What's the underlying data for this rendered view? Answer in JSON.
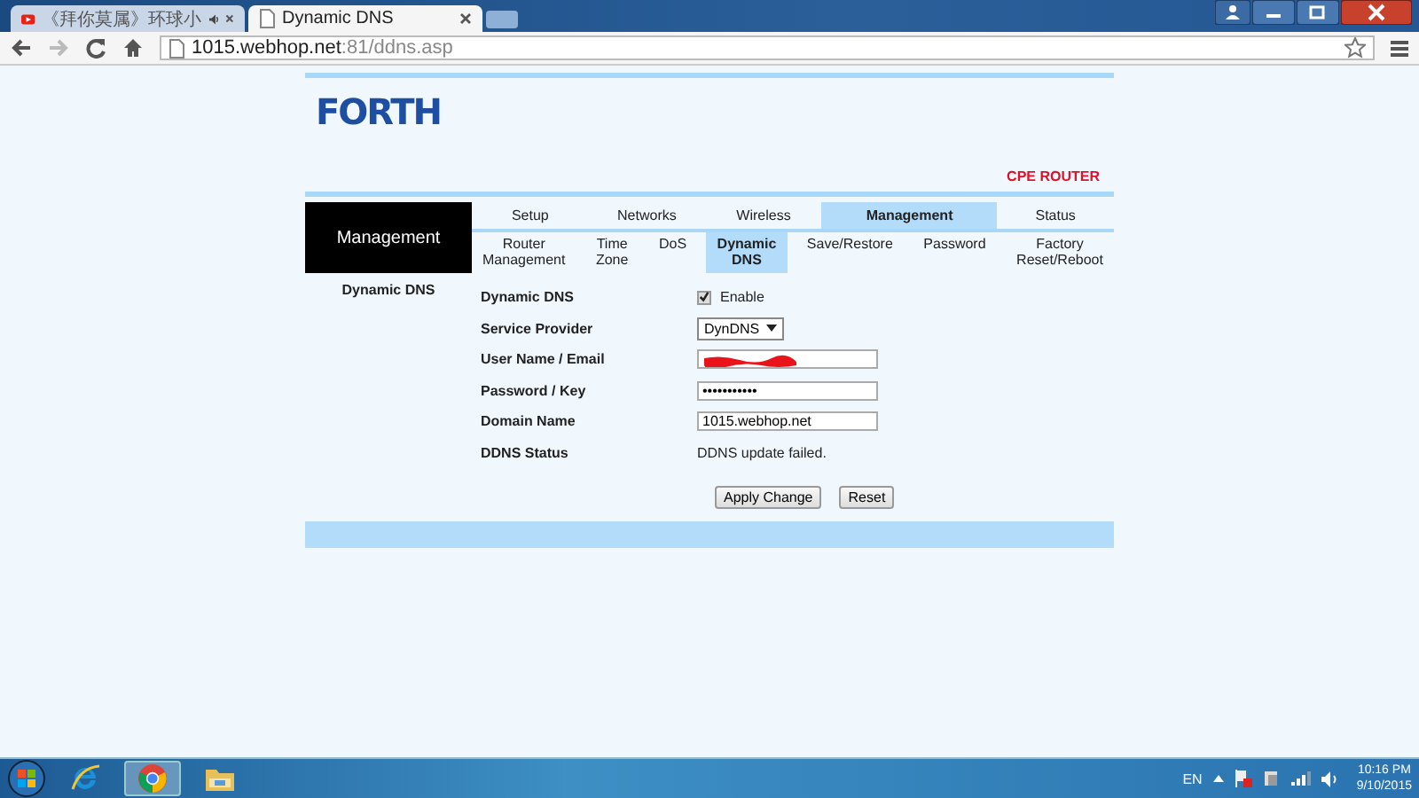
{
  "browser": {
    "tabs": [
      {
        "title": "《拜你莫属》环球小",
        "selected": false,
        "audio": true
      },
      {
        "title": "Dynamic DNS",
        "selected": true,
        "audio": false
      }
    ],
    "address": {
      "host": "1015.webhop.net",
      "rest": ":81/ddns.asp"
    }
  },
  "page": {
    "logo": "FORTH",
    "product": "CPE ROUTER",
    "section": "Management",
    "main_tabs": [
      {
        "label": "Setup",
        "selected": false
      },
      {
        "label": "Networks",
        "selected": false
      },
      {
        "label": "Wireless",
        "selected": false
      },
      {
        "label": "Management",
        "selected": true
      },
      {
        "label": "Status",
        "selected": false
      }
    ],
    "sub_tabs": [
      {
        "label": "Router\nManagement",
        "selected": false
      },
      {
        "label": "Time\nZone",
        "selected": false
      },
      {
        "label": "DoS",
        "selected": false
      },
      {
        "label": "Dynamic\nDNS",
        "selected": true
      },
      {
        "label": "Save/Restore",
        "selected": false
      },
      {
        "label": "Password",
        "selected": false
      },
      {
        "label": "Factory\nReset/Reboot",
        "selected": false
      }
    ],
    "sidebar": [
      {
        "label": "Dynamic DNS",
        "selected": true
      }
    ],
    "form": [
      {
        "kind": "checkbox",
        "label": "Dynamic DNS",
        "option": "Enable",
        "checked": true
      },
      {
        "kind": "select",
        "label": "Service Provider",
        "value": "DynDNS"
      },
      {
        "kind": "redacted",
        "label": "User Name / Email"
      },
      {
        "kind": "input",
        "label": "Password / Key",
        "value": "•••••••••••"
      },
      {
        "kind": "input",
        "label": "Domain Name",
        "value": "1015.webhop.net"
      },
      {
        "kind": "text",
        "label": "DDNS Status",
        "value": "DDNS update failed."
      }
    ],
    "buttons": [
      "Apply Change",
      "Reset"
    ]
  },
  "taskbar": {
    "apps": [
      {
        "kind": "ie",
        "selected": false
      },
      {
        "kind": "chrome",
        "selected": true
      },
      {
        "kind": "folder",
        "selected": false
      }
    ],
    "language": "EN",
    "time": "10:16 PM",
    "date": "9/10/2015"
  }
}
